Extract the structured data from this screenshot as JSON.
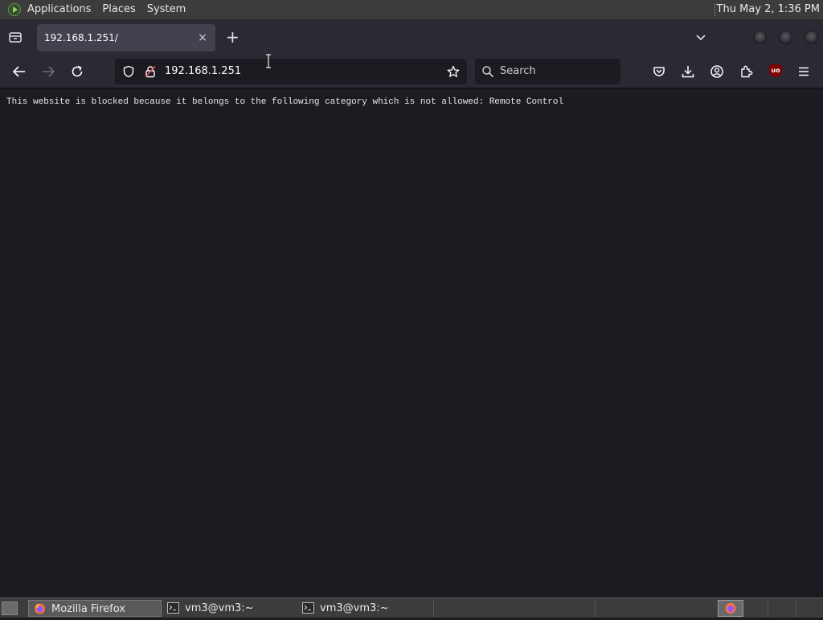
{
  "top_panel": {
    "menus": [
      "Applications",
      "Places",
      "System"
    ],
    "clock": "Thu May  2,  1:36 PM"
  },
  "tabs": {
    "active_title": "192.168.1.251/",
    "close_glyph": "×",
    "new_tab_glyph": "+"
  },
  "toolbar": {
    "url": "192.168.1.251",
    "search_placeholder": "Search",
    "ublock_badge": "uo"
  },
  "page": {
    "message": "This website is blocked because it belongs to the following category which is not allowed: Remote Control"
  },
  "taskbar": {
    "tasks": [
      {
        "label": "Mozilla Firefox",
        "icon": "firefox-icon",
        "active": true
      },
      {
        "label": "vm3@vm3:~",
        "icon": "terminal-icon",
        "active": false
      },
      {
        "label": "vm3@vm3:~",
        "icon": "terminal-icon",
        "active": false
      }
    ]
  },
  "colors": {
    "panel": "#3c3c3c",
    "chrome": "#2b2a33",
    "tab_active": "#42414d",
    "content_bg": "#1c1b22",
    "field_bg": "#1c1b22",
    "ublock_red": "#800000"
  }
}
